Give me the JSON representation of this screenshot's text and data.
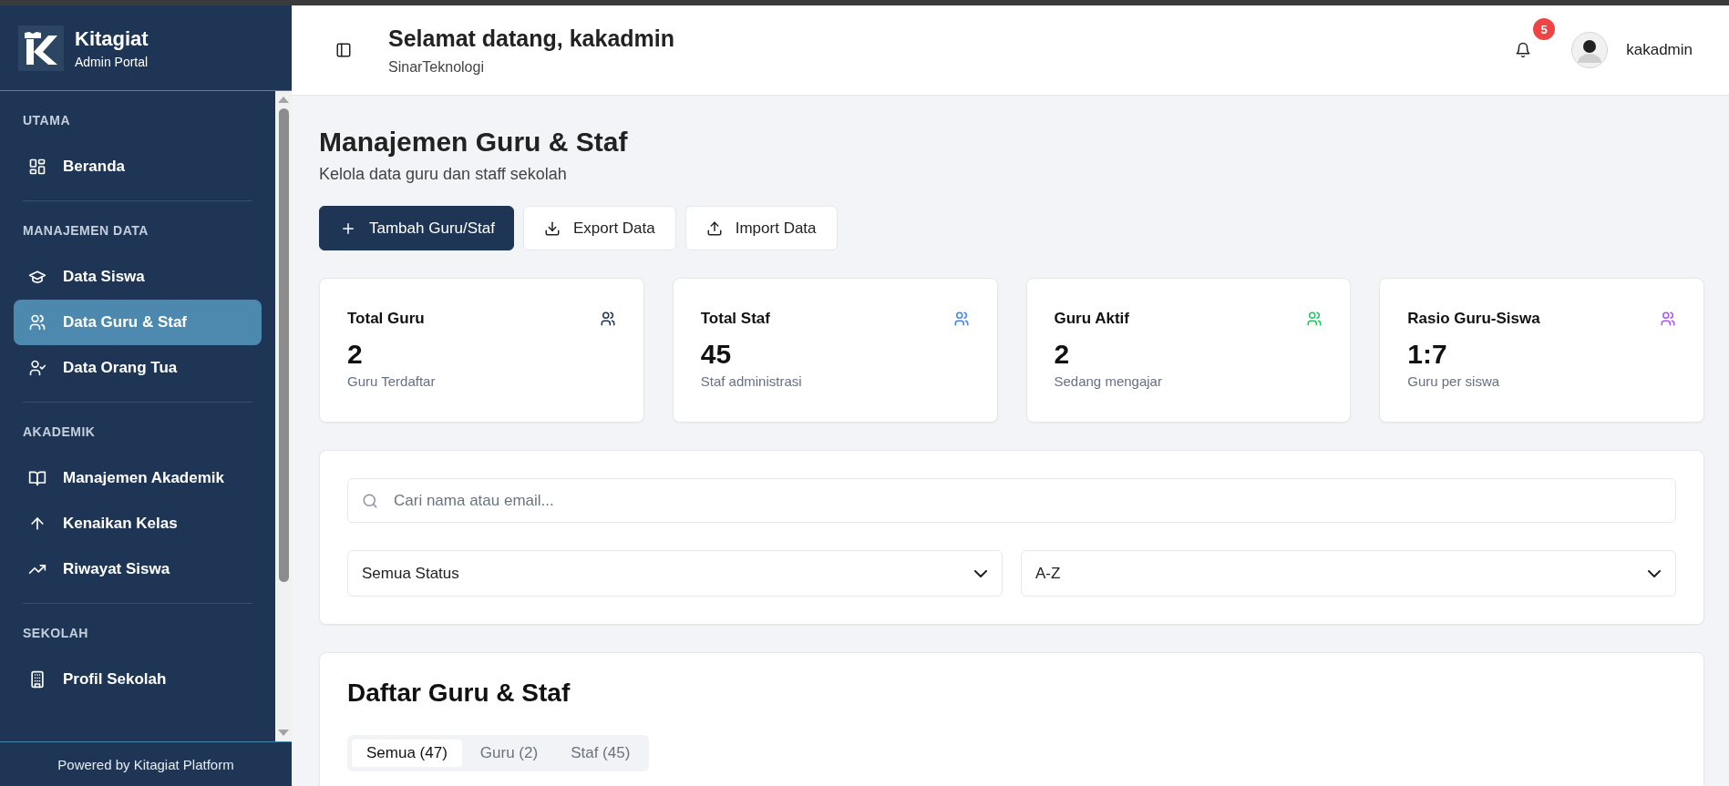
{
  "sidebar": {
    "brand": {
      "name": "Kitagiat",
      "subtitle": "Admin Portal"
    },
    "sections": [
      {
        "heading": "UTAMA",
        "items": [
          {
            "label": "Beranda",
            "selected": false
          }
        ]
      },
      {
        "heading": "MANAJEMEN DATA",
        "items": [
          {
            "label": "Data Siswa",
            "selected": false
          },
          {
            "label": "Data Guru & Staf",
            "selected": true
          },
          {
            "label": "Data Orang Tua",
            "selected": false
          }
        ]
      },
      {
        "heading": "AKADEMIK",
        "items": [
          {
            "label": "Manajemen Akademik",
            "selected": false
          },
          {
            "label": "Kenaikan Kelas",
            "selected": false
          },
          {
            "label": "Riwayat Siswa",
            "selected": false
          }
        ]
      },
      {
        "heading": "SEKOLAH",
        "items": [
          {
            "label": "Profil Sekolah",
            "selected": false
          }
        ]
      }
    ],
    "footer": "Powered by Kitagiat Platform"
  },
  "header": {
    "title": "Selamat datang, kakadmin",
    "subtitle": "SinarTeknologi",
    "notification_count": "5",
    "user": "kakadmin"
  },
  "page": {
    "title": "Manajemen Guru & Staf",
    "subtitle": "Kelola data guru dan staff sekolah",
    "actions": [
      {
        "label": "Tambah Guru/Staf",
        "kind": "primary"
      },
      {
        "label": "Export Data",
        "kind": "export"
      },
      {
        "label": "Import Data",
        "kind": "import"
      }
    ],
    "stats": [
      {
        "title": "Total Guru",
        "value": "2",
        "caption": "Guru Terdaftar",
        "color": "#1e3556"
      },
      {
        "title": "Total Staf",
        "value": "45",
        "caption": "Staf administrasi",
        "color": "#3b82f6"
      },
      {
        "title": "Guru Aktif",
        "value": "2",
        "caption": "Sedang mengajar",
        "color": "#22c55e"
      },
      {
        "title": "Rasio Guru-Siswa",
        "value": "1:7",
        "caption": "Guru per siswa",
        "color": "#a855f7"
      }
    ],
    "filters": {
      "search": {
        "placeholder": "Cari nama atau email..."
      },
      "selects": [
        "Semua Status",
        "A-Z"
      ]
    },
    "list": {
      "title": "Daftar Guru & Staf",
      "tabs": [
        {
          "label": "Semua (47)",
          "selected": true
        },
        {
          "label": "Guru (2)",
          "selected": false
        },
        {
          "label": "Staf (45)",
          "selected": false
        }
      ]
    }
  }
}
